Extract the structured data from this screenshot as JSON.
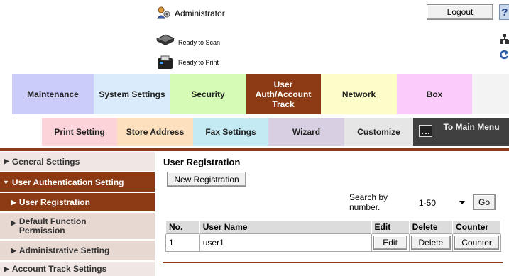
{
  "header": {
    "user_label": "Administrator",
    "logout_label": "Logout",
    "help_label": "?",
    "scan_status": "Ready to Scan",
    "print_status": "Ready to Print"
  },
  "main_tabs": [
    {
      "label": "Maintenance",
      "color": "#ccccfb"
    },
    {
      "label": "System Settings",
      "color": "#d9ebfb"
    },
    {
      "label": "Security",
      "color": "#d6fbb7"
    },
    {
      "label": "User Auth/Account Track",
      "color": "#8b3a14",
      "active": true
    },
    {
      "label": "Network",
      "color": "#fdfdc9"
    },
    {
      "label": "Box",
      "color": "#fbccfb"
    }
  ],
  "sub_tabs": [
    {
      "label": "Print Setting",
      "color": "#fbd3d8"
    },
    {
      "label": "Store Address",
      "color": "#fde0bd"
    },
    {
      "label": "Fax Settings",
      "color": "#c4eaf3"
    },
    {
      "label": "Wizard",
      "color": "#d8d0e2"
    },
    {
      "label": "Customize",
      "color": "#e6e6e6"
    },
    {
      "label": "To Main Menu",
      "color": "#404040"
    }
  ],
  "left_menu": {
    "general": "General Settings",
    "user_auth": "User Authentication Setting",
    "user_registration": "User Registration",
    "default_function_permission": "Default Function Permission",
    "administrative_setting": "Administrative Setting",
    "account_track": "Account Track Settings"
  },
  "content": {
    "title": "User Registration",
    "new_registration_label": "New Registration",
    "search_label": "Search by number.",
    "range_selected": "1-50",
    "go_label": "Go",
    "columns": [
      "No.",
      "User Name",
      "Edit",
      "Delete",
      "Counter"
    ],
    "rows": [
      {
        "no": "1",
        "user_name": "user1",
        "edit": "Edit",
        "delete": "Delete",
        "counter": "Counter"
      }
    ]
  },
  "colors": {
    "accent": "#8b3a14",
    "menu_light": "#f0e6e3",
    "menu_mid": "#e8d8d2"
  }
}
